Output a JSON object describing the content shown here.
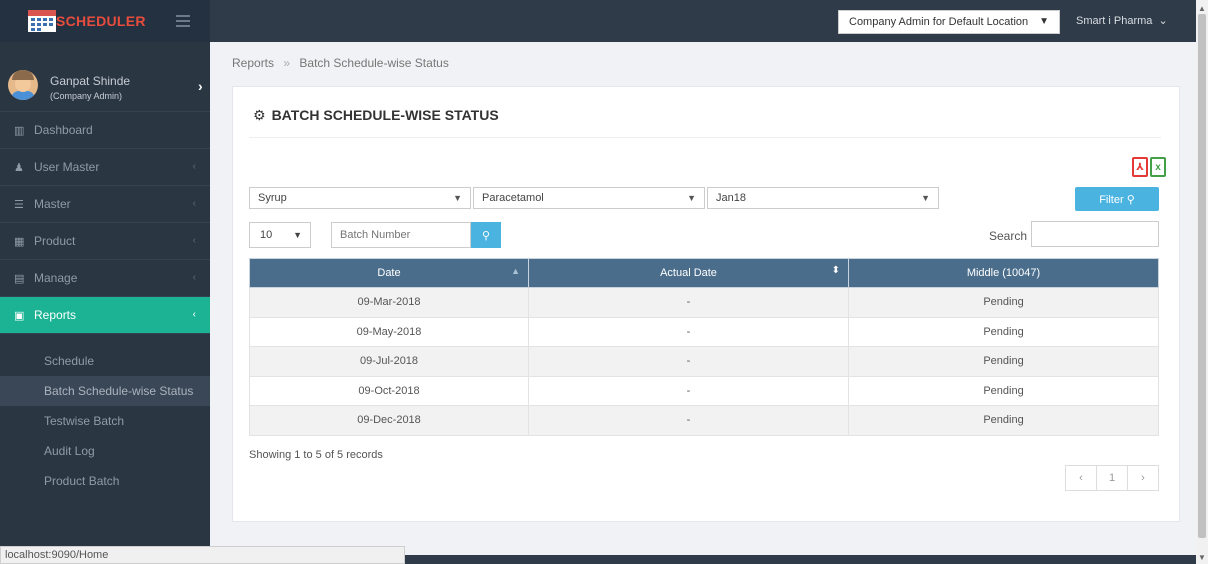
{
  "brand": {
    "name": "SCHEDULER"
  },
  "topbar": {
    "location": "Company Admin for Default Location",
    "user": "Smart i Pharma"
  },
  "profile": {
    "name": "Ganpat Shinde",
    "role": "(Company Admin)"
  },
  "nav": [
    {
      "label": "Dashboard",
      "icon": "bar-chart-icon",
      "active": false
    },
    {
      "label": "User Master",
      "icon": "user-icon",
      "active": false
    },
    {
      "label": "Master",
      "icon": "list-icon",
      "active": false
    },
    {
      "label": "Product",
      "icon": "product-icon",
      "active": false
    },
    {
      "label": "Manage",
      "icon": "calendar-icon",
      "active": false
    },
    {
      "label": "Reports",
      "icon": "report-icon",
      "active": true
    }
  ],
  "submenu": [
    {
      "label": "Schedule",
      "active": false
    },
    {
      "label": "Batch Schedule-wise Status",
      "active": true
    },
    {
      "label": "Testwise Batch",
      "active": false
    },
    {
      "label": "Audit Log",
      "active": false
    },
    {
      "label": "Product Batch",
      "active": false
    }
  ],
  "breadcrumb": {
    "root": "Reports",
    "current": "Batch Schedule-wise Status"
  },
  "page": {
    "title": "BATCH SCHEDULE-WISE STATUS"
  },
  "filters": {
    "category": "Syrup",
    "product": "Paracetamol",
    "batch": "Jan18",
    "filter_label": "Filter"
  },
  "table_controls": {
    "page_length": "10",
    "batch_placeholder": "Batch Number",
    "search_label": "Search"
  },
  "table": {
    "headers": [
      "Date",
      "Actual Date",
      "Middle (10047)"
    ],
    "rows": [
      [
        "09-Mar-2018",
        "-",
        "Pending"
      ],
      [
        "09-May-2018",
        "-",
        "Pending"
      ],
      [
        "09-Jul-2018",
        "-",
        "Pending"
      ],
      [
        "09-Oct-2018",
        "-",
        "Pending"
      ],
      [
        "09-Dec-2018",
        "-",
        "Pending"
      ]
    ]
  },
  "pagination": {
    "summary": "Showing 1 to 5 of 5 records",
    "prev": "‹",
    "page": "1",
    "next": "›"
  },
  "statusbar": {
    "url": "localhost:9090/Home"
  }
}
